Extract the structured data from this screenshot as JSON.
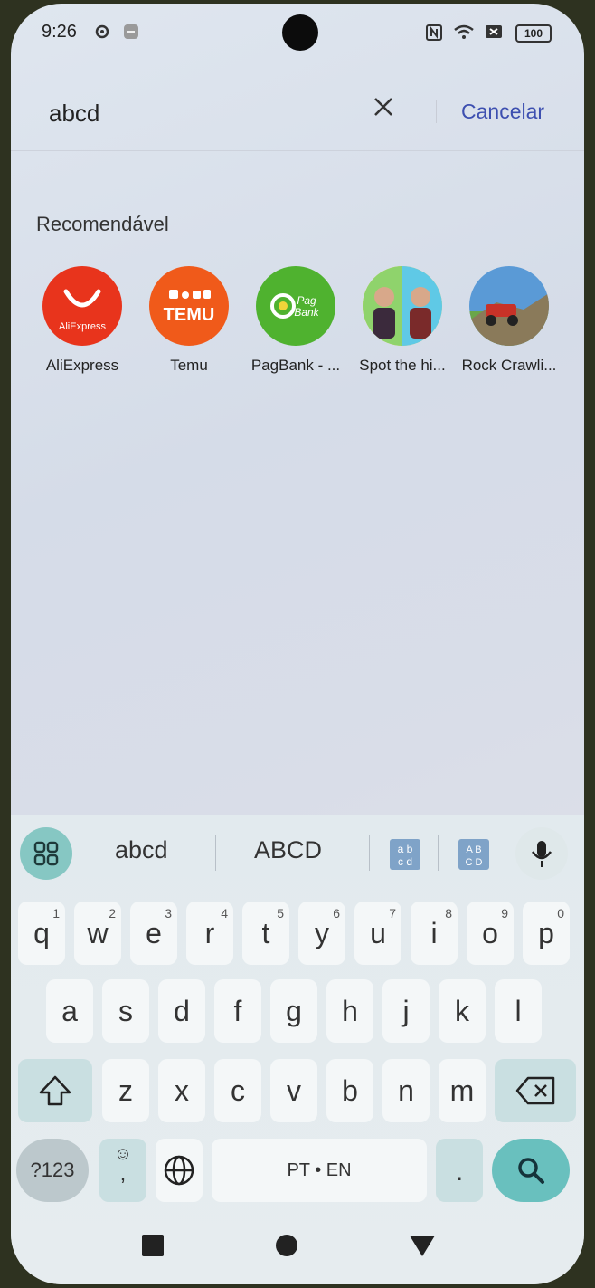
{
  "status_bar": {
    "time": "9:26",
    "battery": "100",
    "icons": [
      "settings-icon",
      "minus-icon",
      "nfc-icon",
      "wifi-icon",
      "sim-icon"
    ]
  },
  "search": {
    "value": "abcd",
    "clear_icon": "close-icon",
    "cancel_label": "Cancelar"
  },
  "recommended": {
    "title": "Recomendável",
    "apps": [
      {
        "label": "AliExpress",
        "icon": "aliexpress-icon",
        "color": "#e8341c",
        "icon_text": "AliExpress"
      },
      {
        "label": "Temu",
        "icon": "temu-icon",
        "color": "#f05a1a",
        "icon_text": "TEMU"
      },
      {
        "label": "PagBank - ...",
        "icon": "pagbank-icon",
        "color": "#4fb22f",
        "icon_text": "Pag Bank"
      },
      {
        "label": "Spot the hi...",
        "icon": "spot-the-hidden-icon",
        "color": "#f1d53a"
      },
      {
        "label": "Rock Crawli...",
        "icon": "rock-crawling-icon",
        "color": "#5a9ad6"
      }
    ]
  },
  "keyboard": {
    "suggestions": [
      "abcd",
      "ABCD"
    ],
    "row1": [
      {
        "k": "q",
        "n": "1"
      },
      {
        "k": "w",
        "n": "2"
      },
      {
        "k": "e",
        "n": "3"
      },
      {
        "k": "r",
        "n": "4"
      },
      {
        "k": "t",
        "n": "5"
      },
      {
        "k": "y",
        "n": "6"
      },
      {
        "k": "u",
        "n": "7"
      },
      {
        "k": "i",
        "n": "8"
      },
      {
        "k": "o",
        "n": "9"
      },
      {
        "k": "p",
        "n": "0"
      }
    ],
    "row2": [
      "a",
      "s",
      "d",
      "f",
      "g",
      "h",
      "j",
      "k",
      "l"
    ],
    "row3": [
      "z",
      "x",
      "c",
      "v",
      "b",
      "n",
      "m"
    ],
    "symbols_label": "?123",
    "emoji_label": "☺",
    "comma_label": ",",
    "space_label": "PT • EN",
    "period_label": "."
  },
  "colors": {
    "accent": "#69c0be",
    "cancel": "#3d4fb0"
  }
}
